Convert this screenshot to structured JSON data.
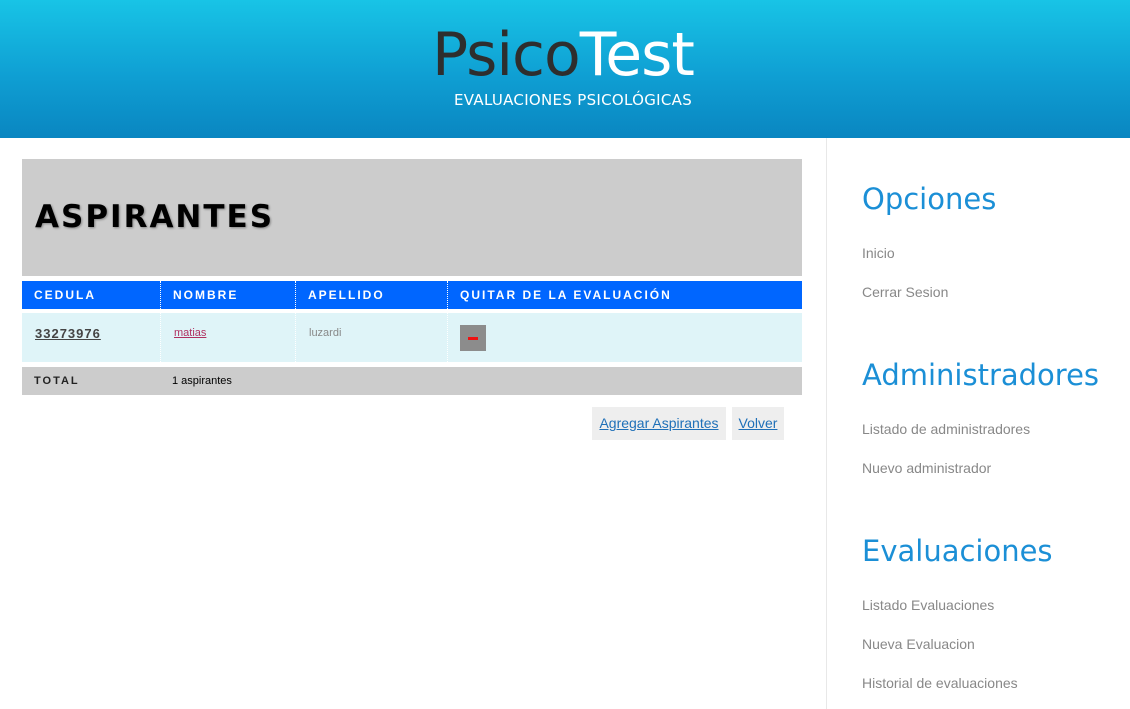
{
  "brand": {
    "name_dark": "Psico",
    "name_light": "Test",
    "tagline": "EVALUACIONES PSICOLÓGICAS"
  },
  "page": {
    "title": "ASPIRANTES"
  },
  "table": {
    "headers": [
      "CEDULA",
      "NOMBRE",
      "APELLIDO",
      "QUITAR DE LA EVALUACIÓN"
    ],
    "rows": [
      {
        "cedula": "33273976",
        "nombre": "matias",
        "apellido": "luzardi",
        "remove_icon": "minus-icon"
      }
    ],
    "total_label": "TOTAL",
    "total_value": "1 aspirantes"
  },
  "actions": {
    "add_label": "Agregar Aspirantes",
    "back_label": "Volver"
  },
  "sidebar": {
    "sections": [
      {
        "title": "Opciones",
        "links": [
          "Inicio",
          "Cerrar Sesion"
        ]
      },
      {
        "title": "Administradores",
        "links": [
          "Listado de administradores",
          "Nuevo administrador"
        ]
      },
      {
        "title": "Evaluaciones",
        "links": [
          "Listado Evaluaciones",
          "Nueva Evaluacion",
          "Historial de evaluaciones"
        ]
      }
    ]
  },
  "colors": {
    "header_gradient": [
      "#18c4e6",
      "#0a86c1"
    ],
    "table_header": "#0066ff",
    "row_bg": "#dff4f8",
    "sidebar_heading": "#1b8fd6",
    "link": "#1f70b8"
  }
}
